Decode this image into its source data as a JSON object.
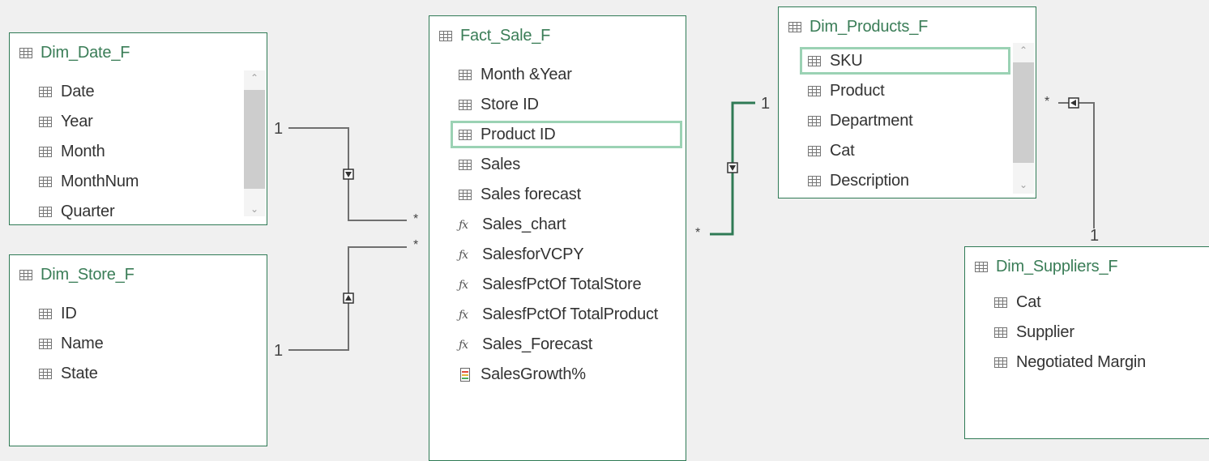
{
  "tables": {
    "dim_date": {
      "title": "Dim_Date_F",
      "fields": [
        "Date",
        "Year",
        "Month",
        "MonthNum",
        "Quarter"
      ]
    },
    "dim_store": {
      "title": "Dim_Store_F",
      "fields": [
        "ID",
        "Name",
        "State"
      ]
    },
    "fact_sale": {
      "title": "Fact_Sale_F",
      "columns": [
        "Month &Year",
        "Store ID",
        "Product ID",
        "Sales",
        "Sales forecast"
      ],
      "measures": [
        "Sales_chart",
        "SalesforVCPY",
        "SalesfPctOf TotalStore",
        "SalesfPctOf TotalProduct",
        "Sales_Forecast"
      ],
      "kpi": "SalesGrowth%"
    },
    "dim_products": {
      "title": "Dim_Products_F",
      "fields": [
        "SKU",
        "Product",
        "Department",
        "Cat",
        "Description"
      ]
    },
    "dim_suppliers": {
      "title": "Dim_Suppliers_F",
      "fields": [
        "Cat",
        "Supplier",
        "Negotiated Margin"
      ]
    }
  },
  "relationships": {
    "date_fact": {
      "one": "1",
      "many": "*"
    },
    "store_fact": {
      "one": "1",
      "many": "*"
    },
    "fact_products": {
      "one": "1",
      "many": "*"
    },
    "products_suppliers": {
      "one": "1",
      "many": "*"
    }
  },
  "colors": {
    "table_border": "#2f7a55",
    "title_text": "#3a7d57",
    "highlight": "#9bd2b4",
    "active_line": "#2f7a55",
    "line": "#707070",
    "background": "#f0f0f0"
  },
  "icons": {
    "column": "table-icon",
    "measure": "fx-icon",
    "kpi": "kpi-icon"
  }
}
